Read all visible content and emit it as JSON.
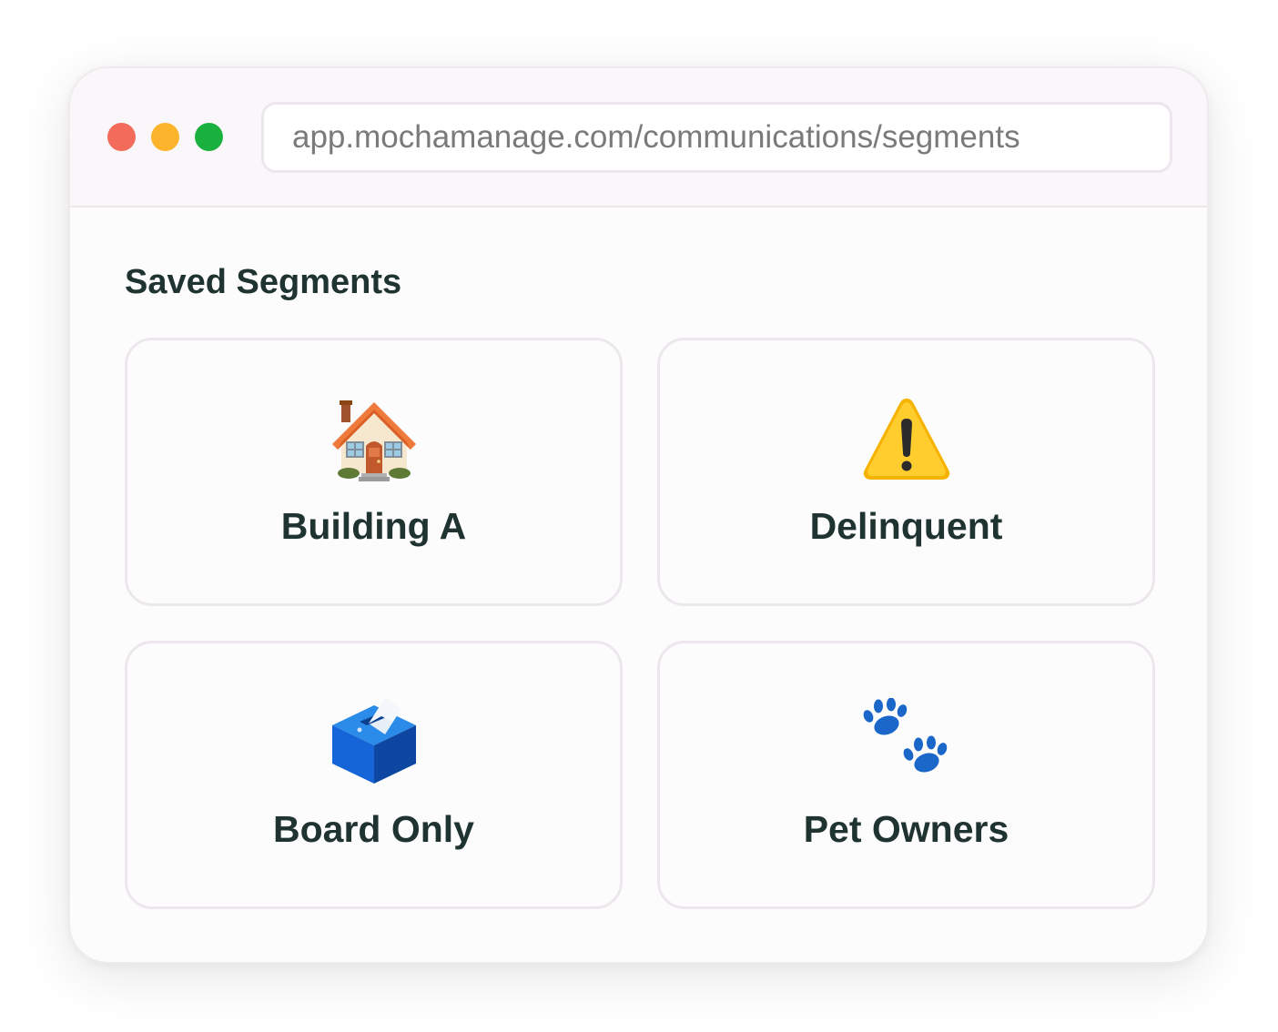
{
  "browser": {
    "url": "app.mochamanage.com/communications/segments",
    "traffic_lights": {
      "close_color": "#f26b5b",
      "minimize_color": "#fcb42d",
      "maximize_color": "#1bb13f"
    }
  },
  "main": {
    "section_title": "Saved Segments",
    "segments": [
      {
        "label": "Building A",
        "icon": "house-icon"
      },
      {
        "label": "Delinquent",
        "icon": "warning-icon"
      },
      {
        "label": "Board Only",
        "icon": "ballot-box-icon"
      },
      {
        "label": "Pet Owners",
        "icon": "paw-prints-icon"
      }
    ]
  }
}
